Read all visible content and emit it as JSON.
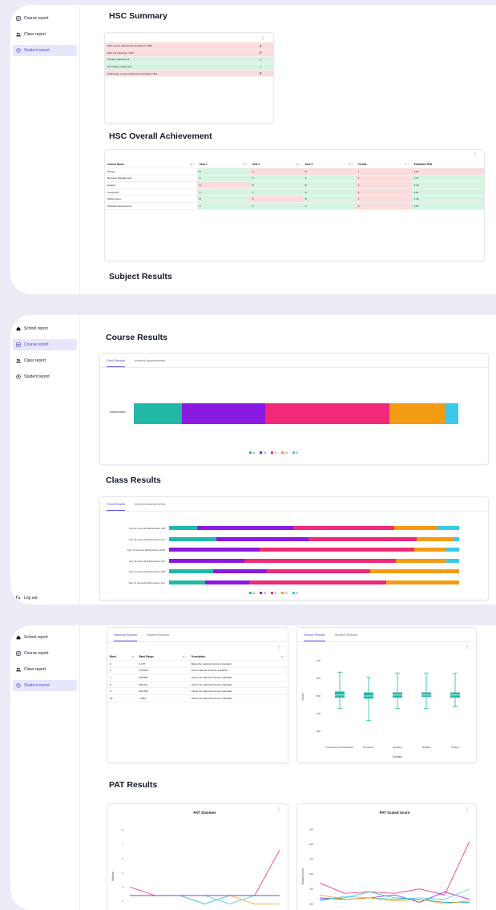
{
  "colors": {
    "A": "#22b8a8",
    "B": "#8b1ae0",
    "C": "#f02a78",
    "D": "#f39c12",
    "E": "#3cc8e8",
    "accent": "#4f46e5"
  },
  "panel1": {
    "nav": [
      {
        "label": "Course report",
        "icon": "grid-icon",
        "active": false
      },
      {
        "label": "Class report",
        "icon": "users-icon",
        "active": false
      },
      {
        "label": "Student report",
        "icon": "user-icon",
        "active": true
      }
    ],
    "hsc_summary_title": "HSC Summary",
    "summary_rows": [
      {
        "label": "HSC course requirement (Credits) ≥ 1408",
        "mark": "✗",
        "status": "fail"
      },
      {
        "label": "HSC not achieved - #4%",
        "mark": "✗",
        "status": "fail"
      },
      {
        "label": "Literacy requirement",
        "mark": "✓",
        "status": "pass"
      },
      {
        "label": "Numeracy requirement",
        "mark": "✓",
        "status": "pass"
      },
      {
        "label": "Preliminary course requirement (Credits) ≥ 812",
        "mark": "✗",
        "status": "fail"
      }
    ],
    "achievement_title": "HSC Overall Achievement",
    "achievement_headers": [
      "Course Name",
      "Task 1",
      "Task 2",
      "Task 3",
      "Credits",
      "Estimated GPA"
    ],
    "achievement_rows": [
      {
        "cells": [
          "Biology",
          "B",
          "C",
          "B",
          "1",
          "2.51"
        ],
        "tones": [
          "",
          "green",
          "pink",
          "pink",
          "pink",
          "pink"
        ]
      },
      {
        "cells": [
          "Business Management",
          "C",
          "C",
          "A",
          "3",
          "3.47"
        ],
        "tones": [
          "",
          "green",
          "green",
          "green",
          "pink",
          "green"
        ]
      },
      {
        "cells": [
          "English",
          "D",
          "B",
          "B",
          "3",
          "3.43"
        ],
        "tones": [
          "",
          "pink",
          "green",
          "green",
          "pink",
          "green"
        ]
      },
      {
        "cells": [
          "Geography",
          "C",
          "C",
          "B",
          "3",
          "3.21"
        ],
        "tones": [
          "",
          "green",
          "green",
          "green",
          "pink",
          "green"
        ]
      },
      {
        "cells": [
          "Mathematics",
          "B",
          "D",
          "B",
          "3",
          "3.43"
        ],
        "tones": [
          "",
          "green",
          "pink",
          "green",
          "pink",
          "green"
        ]
      },
      {
        "cells": [
          "Software Development",
          "C",
          "C",
          "C",
          "3",
          "3.35"
        ],
        "tones": [
          "",
          "green",
          "green",
          "green",
          "pink",
          "green"
        ]
      }
    ],
    "subject_results_title": "Subject Results"
  },
  "panel2": {
    "nav": [
      {
        "label": "School report",
        "icon": "home-icon",
        "active": false
      },
      {
        "label": "Course report",
        "icon": "grid-icon",
        "active": true
      },
      {
        "label": "Class report",
        "icon": "users-icon",
        "active": false
      },
      {
        "label": "Student report",
        "icon": "user-icon",
        "active": false
      }
    ],
    "logout": "Log out",
    "course_title": "Course Results",
    "class_title": "Class Results",
    "tab_final": "Final Results",
    "tab_internal": "Internal Assessments",
    "legend": [
      "A",
      "B",
      "C",
      "D",
      "E"
    ],
    "course_bar_label": "Mathematics",
    "course_bar": [
      14,
      24,
      36,
      16,
      4
    ],
    "class_bars": [
      {
        "label": "Year 11 General Mathematics 11B",
        "values": [
          10,
          34,
          36,
          15,
          8
        ]
      },
      {
        "label": "Year 11 General Mathematics 11C",
        "values": [
          18,
          35,
          41,
          14,
          2
        ]
      },
      {
        "label": "Year 11 General Mathematics 11CD",
        "values": [
          0,
          28,
          48,
          10,
          4
        ]
      },
      {
        "label": "Year 11 General Mathematics 11H",
        "values": [
          0,
          24,
          48,
          16,
          4
        ]
      },
      {
        "label": "Year 12 General Mathematics 12B",
        "values": [
          15,
          18,
          35,
          30,
          0
        ]
      },
      {
        "label": "Year 12 General Mathematics 12C",
        "values": [
          10,
          12,
          38,
          20,
          0
        ]
      }
    ]
  },
  "panel3": {
    "nav": [
      {
        "label": "School report",
        "icon": "home-icon",
        "active": false
      },
      {
        "label": "Course report",
        "icon": "grid-icon",
        "active": false
      },
      {
        "label": "Class report",
        "icon": "users-icon",
        "active": false
      },
      {
        "label": "Student report",
        "icon": "user-icon",
        "active": true
      }
    ],
    "left_tab_national": "National Results",
    "left_tab_student": "Student Results",
    "band_headers": [
      "Band",
      "Band Range",
      "Description"
    ],
    "band_rows": [
      [
        "3",
        "0-478",
        "Below the national minimum standard"
      ],
      [
        "6",
        "478-539",
        "At the national minimum standard"
      ],
      [
        "7",
        "539-583",
        "Above the national minimum standard"
      ],
      [
        "8",
        "583-634",
        "Above the national minimum standard"
      ],
      [
        "9",
        "634-699",
        "Above the national minimum standard"
      ],
      [
        "10",
        ">=699",
        "Above the national minimum standard"
      ]
    ],
    "right_tab_school": "School Results",
    "right_tab_student": "Student Results",
    "pat_title": "PAT Results"
  },
  "chart_data": [
    {
      "type": "box",
      "xlabel": "Domain",
      "ylabel": "Score",
      "yticks": [
        "700",
        "600",
        "500",
        "400",
        "300"
      ],
      "categories": [
        "Grammar and Punctuation",
        "Numeracy",
        "Reading",
        "Spelling",
        "Writing"
      ],
      "boxes": [
        {
          "min": 430,
          "q1": 490,
          "median": 505,
          "q3": 525,
          "max": 635
        },
        {
          "min": 360,
          "q1": 485,
          "median": 500,
          "q3": 520,
          "max": 605
        },
        {
          "min": 430,
          "q1": 490,
          "median": 505,
          "q3": 520,
          "max": 630
        },
        {
          "min": 430,
          "q1": 495,
          "median": 505,
          "q3": 520,
          "max": 630
        },
        {
          "min": 440,
          "q1": 490,
          "median": 505,
          "q3": 520,
          "max": 630
        }
      ]
    },
    {
      "type": "line",
      "title": "PAT Stanines",
      "ylabel": "Stanine",
      "yticks": [
        "8",
        "7",
        "6",
        "5",
        "4",
        "3"
      ],
      "x": [
        1,
        2,
        3,
        4,
        5,
        6,
        7
      ],
      "ylim": [
        2.6,
        8.6
      ],
      "series": [
        {
          "color": "#f02a78",
          "values": [
            4,
            3.4,
            3.4,
            3.4,
            3.4,
            3.4,
            6.6
          ]
        },
        {
          "color": "#22b8a8",
          "values": [
            3.4,
            3.4,
            3.4,
            2.8,
            3.4,
            3.4,
            3.4
          ]
        },
        {
          "color": "#3cc8e8",
          "values": [
            3.4,
            3.4,
            3.4,
            3.4,
            2.8,
            3.4,
            3.4
          ]
        },
        {
          "color": "#f39c12",
          "values": [
            3.4,
            3.4,
            3.4,
            3.4,
            3.4,
            2.8,
            2.8
          ]
        },
        {
          "color": "#8b1ae0",
          "values": [
            3.4,
            3.4,
            3.4,
            3.4,
            3.4,
            3.4,
            3.4
          ]
        }
      ]
    },
    {
      "type": "line",
      "title": "PAT Scaled Score",
      "ylabel": "Scaled Score",
      "yticks": [
        "150",
        "140",
        "130",
        "120",
        "110",
        "100"
      ],
      "x": [
        1,
        2,
        3,
        4,
        5,
        6,
        7
      ],
      "ylim": [
        98,
        155
      ],
      "series": [
        {
          "color": "#f02a78",
          "values": [
            114,
            107,
            108,
            107,
            110,
            106,
            142
          ]
        },
        {
          "color": "#8b1ae0",
          "values": [
            104,
            103,
            104,
            106,
            101,
            108,
            103
          ]
        },
        {
          "color": "#22b8a8",
          "values": [
            103,
            104,
            108,
            104,
            103,
            101,
            101
          ]
        },
        {
          "color": "#3cc8e8",
          "values": [
            102,
            105,
            104,
            103,
            104,
            103,
            110
          ]
        },
        {
          "color": "#f39c12",
          "values": [
            106,
            103,
            104,
            102,
            103,
            100,
            102
          ]
        }
      ]
    }
  ]
}
